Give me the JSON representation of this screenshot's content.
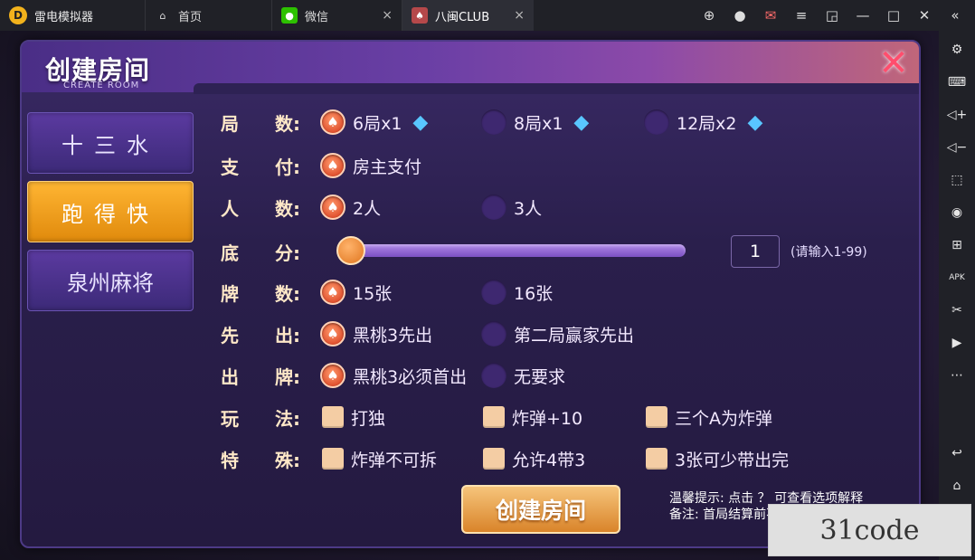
{
  "app": {
    "title": "雷电模拟器",
    "logo_glyph": "D"
  },
  "tabs": [
    {
      "label": "首页",
      "icon": "home-icon"
    },
    {
      "label": "微信",
      "icon": "wechat-icon",
      "close": "×"
    },
    {
      "label": "八闽CLUB",
      "icon": "game-icon",
      "close": "×"
    }
  ],
  "window_controls": [
    "gamepad-icon",
    "user-icon",
    "mail-icon",
    "menu-icon",
    "restore-icon",
    "minimize-icon",
    "maximize-icon",
    "close-icon",
    "collapse-icon"
  ],
  "sidebar_tools": [
    "settings-icon",
    "keyboard-icon",
    "volume-up-icon",
    "volume-down-icon",
    "screenshot-icon",
    "record-icon",
    "add-app-icon",
    "apk-icon",
    "scissors-icon",
    "video-icon",
    "more-icon",
    "back-icon",
    "home-icon"
  ],
  "dialog": {
    "title": "创建房间",
    "subtitle": "CREATE ROOM",
    "close_glyph": "✕",
    "modes": [
      {
        "label": "十三水",
        "active": false
      },
      {
        "label": "跑得快",
        "active": true
      },
      {
        "label": "泉州麻将",
        "active": false
      }
    ],
    "rows": {
      "rounds": {
        "l1": "局",
        "l2": "数:",
        "options": [
          "6局x1",
          "8局x1",
          "12局x2"
        ],
        "selected": 0
      },
      "pay": {
        "l1": "支",
        "l2": "付:",
        "options": [
          "房主支付"
        ],
        "selected": 0
      },
      "players": {
        "l1": "人",
        "l2": "数:",
        "options": [
          "2人",
          "3人"
        ],
        "selected": 0
      },
      "base": {
        "l1": "底",
        "l2": "分:",
        "value": "1",
        "hint": "(请输入1-99)",
        "slider_fraction": 0.0
      },
      "cards": {
        "l1": "牌",
        "l2": "数:",
        "options": [
          "15张",
          "16张"
        ],
        "selected": 0
      },
      "first": {
        "l1": "先",
        "l2": "出:",
        "options": [
          "黑桃3先出",
          "第二局赢家先出"
        ],
        "selected": 0
      },
      "lead": {
        "l1": "出",
        "l2": "牌:",
        "options": [
          "黑桃3必须首出",
          "无要求"
        ],
        "selected": 0
      },
      "play": {
        "l1": "玩",
        "l2": "法:",
        "options": [
          "打独",
          "炸弹+10",
          "三个A为炸弹"
        ]
      },
      "special": {
        "l1": "特",
        "l2": "殊:",
        "options": [
          "炸弹不可拆",
          "允许4带3",
          "3张可少带出完"
        ]
      }
    },
    "create_button": "创建房间",
    "tip1": "温馨提示: 点击 ？ 可查看选项解释",
    "tip2": "备注: 首局结算前不扣除钻石"
  },
  "watermark": "31code",
  "colors": {
    "accent_orange": "#e08a0c",
    "panel_purple": "#2a1f4c",
    "gem_blue": "#59c6ff"
  }
}
